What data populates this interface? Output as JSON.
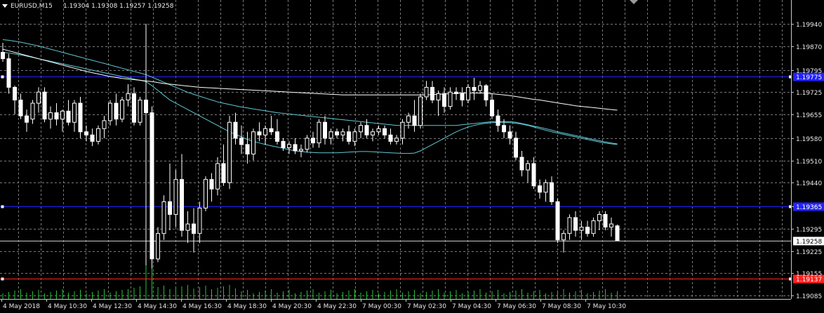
{
  "header": {
    "symbol": "EURUSD,M15",
    "ohlc": "1.19304 1.19308 1.19257 1.19258"
  },
  "chart_data": {
    "type": "candlestick",
    "title": "EURUSD,M15",
    "ylim": [
      1.19085,
      1.19975
    ],
    "y_ticks": [
      "1.19940",
      "1.19870",
      "1.19795",
      "1.19725",
      "1.19655",
      "1.19580",
      "1.19510",
      "1.19440",
      "1.19365",
      "1.19295",
      "1.19225",
      "1.19155",
      "1.19085"
    ],
    "x_ticks": [
      "4 May 2018",
      "4 May 10:30",
      "4 May 12:30",
      "4 May 14:30",
      "4 May 16:30",
      "4 May 18:30",
      "4 May 20:30",
      "4 May 22:30",
      "7 May 00:30",
      "7 May 02:30",
      "7 May 04:30",
      "7 May 06:30",
      "7 May 08:30",
      "7 May 10:30"
    ],
    "grid": true,
    "background": "#000000",
    "colors": {
      "grid": "#7a7a7a",
      "candle": "#ffffff",
      "ma": "#ffffff",
      "bands": "#5fc9d4",
      "hline_blue": "#2222ff",
      "hline_red": "#ff2020",
      "bid": "#c8c8c8"
    },
    "horizontal_lines": [
      {
        "value": 1.19775,
        "label": "1.19775",
        "color": "#2222ff"
      },
      {
        "value": 1.19365,
        "label": "1.19365",
        "color": "#2222ff"
      },
      {
        "value": 1.19137,
        "label": "1.19137",
        "color": "#ff2020"
      }
    ],
    "bid": {
      "value": 1.19258,
      "label": "1.19258"
    },
    "candles": [
      [
        1.1985,
        1.1988,
        1.1982,
        1.1983
      ],
      [
        1.1983,
        1.19845,
        1.1972,
        1.1974
      ],
      [
        1.1974,
        1.19745,
        1.19655,
        1.197
      ],
      [
        1.197,
        1.1972,
        1.1964,
        1.1965
      ],
      [
        1.1965,
        1.1967,
        1.196,
        1.1963
      ],
      [
        1.1964,
        1.197,
        1.19625,
        1.1969
      ],
      [
        1.1969,
        1.1974,
        1.1966,
        1.19725
      ],
      [
        1.19725,
        1.1974,
        1.1963,
        1.1964
      ],
      [
        1.1964,
        1.1968,
        1.1961,
        1.1966
      ],
      [
        1.1966,
        1.1969,
        1.1962,
        1.1964
      ],
      [
        1.1964,
        1.1967,
        1.196,
        1.19665
      ],
      [
        1.19665,
        1.197,
        1.1962,
        1.1963
      ],
      [
        1.1963,
        1.197,
        1.196,
        1.1969
      ],
      [
        1.1969,
        1.1971,
        1.1958,
        1.196
      ],
      [
        1.196,
        1.1962,
        1.1957,
        1.1959
      ],
      [
        1.1959,
        1.1961,
        1.19555,
        1.1957
      ],
      [
        1.1957,
        1.1962,
        1.1956,
        1.1961
      ],
      [
        1.1961,
        1.1965,
        1.1958,
        1.19635
      ],
      [
        1.19635,
        1.197,
        1.1962,
        1.1969
      ],
      [
        1.1969,
        1.1972,
        1.1962,
        1.1964
      ],
      [
        1.1964,
        1.1971,
        1.1963,
        1.197
      ],
      [
        1.197,
        1.1975,
        1.1968,
        1.1972
      ],
      [
        1.1972,
        1.1974,
        1.1962,
        1.1963
      ],
      [
        1.1963,
        1.1971,
        1.1962,
        1.197
      ],
      [
        1.197,
        1.1994,
        1.1918,
        1.1966
      ],
      [
        1.1966,
        1.1968,
        1.1917,
        1.192
      ],
      [
        1.192,
        1.193,
        1.1919,
        1.1928
      ],
      [
        1.1928,
        1.194,
        1.1926,
        1.1938
      ],
      [
        1.1938,
        1.195,
        1.1929,
        1.1934
      ],
      [
        1.1934,
        1.1948,
        1.193,
        1.1945
      ],
      [
        1.1945,
        1.1953,
        1.1927,
        1.1929
      ],
      [
        1.1929,
        1.1935,
        1.1925,
        1.1931
      ],
      [
        1.1931,
        1.1936,
        1.1922,
        1.1928
      ],
      [
        1.1928,
        1.1938,
        1.1925,
        1.1936
      ],
      [
        1.1936,
        1.1946,
        1.1935,
        1.1945
      ],
      [
        1.1945,
        1.1947,
        1.1938,
        1.1942
      ],
      [
        1.1942,
        1.1952,
        1.194,
        1.195
      ],
      [
        1.195,
        1.1956,
        1.1943,
        1.1944
      ],
      [
        1.1944,
        1.1965,
        1.1942,
        1.1963
      ],
      [
        1.1963,
        1.1966,
        1.1956,
        1.1958
      ],
      [
        1.1958,
        1.1962,
        1.1953,
        1.1956
      ],
      [
        1.1956,
        1.196,
        1.195,
        1.1953
      ],
      [
        1.1953,
        1.1961,
        1.1951,
        1.196
      ],
      [
        1.196,
        1.1963,
        1.1957,
        1.1959
      ],
      [
        1.1959,
        1.1962,
        1.1956,
        1.1961
      ],
      [
        1.1961,
        1.1965,
        1.1959,
        1.196
      ],
      [
        1.196,
        1.1964,
        1.1956,
        1.1957
      ],
      [
        1.1957,
        1.1958,
        1.1954,
        1.1955
      ],
      [
        1.1955,
        1.1957,
        1.1953,
        1.1956
      ],
      [
        1.1956,
        1.1958,
        1.1953,
        1.1954
      ],
      [
        1.1954,
        1.1956,
        1.1952,
        1.19545
      ],
      [
        1.19545,
        1.1959,
        1.19535,
        1.1958
      ],
      [
        1.1958,
        1.196,
        1.1955,
        1.19565
      ],
      [
        1.19565,
        1.1964,
        1.1955,
        1.1963
      ],
      [
        1.1963,
        1.1965,
        1.1956,
        1.1958
      ],
      [
        1.1958,
        1.1961,
        1.1956,
        1.196
      ],
      [
        1.196,
        1.1961,
        1.1958,
        1.1959
      ],
      [
        1.1959,
        1.1961,
        1.1957,
        1.196
      ],
      [
        1.196,
        1.1962,
        1.1956,
        1.1957
      ],
      [
        1.1957,
        1.1961,
        1.19555,
        1.196
      ],
      [
        1.196,
        1.1963,
        1.1958,
        1.1962
      ],
      [
        1.1962,
        1.1964,
        1.1958,
        1.1959
      ],
      [
        1.1959,
        1.1961,
        1.1957,
        1.196
      ],
      [
        1.196,
        1.1962,
        1.1959,
        1.1961
      ],
      [
        1.1961,
        1.1962,
        1.1958,
        1.1959
      ],
      [
        1.1959,
        1.1961,
        1.1956,
        1.1957
      ],
      [
        1.1957,
        1.1959,
        1.1956,
        1.1958
      ],
      [
        1.1958,
        1.1964,
        1.1956,
        1.1963
      ],
      [
        1.1963,
        1.1966,
        1.1961,
        1.1965
      ],
      [
        1.1965,
        1.197,
        1.196,
        1.1962
      ],
      [
        1.1962,
        1.1972,
        1.1961,
        1.1971
      ],
      [
        1.1971,
        1.1976,
        1.197,
        1.1974
      ],
      [
        1.1974,
        1.1976,
        1.1969,
        1.197
      ],
      [
        1.197,
        1.1973,
        1.1965,
        1.1972
      ],
      [
        1.1972,
        1.1974,
        1.1966,
        1.1968
      ],
      [
        1.1968,
        1.1974,
        1.1967,
        1.19725
      ],
      [
        1.19725,
        1.1974,
        1.197,
        1.1972
      ],
      [
        1.1972,
        1.1974,
        1.1968,
        1.197
      ],
      [
        1.197,
        1.1975,
        1.1969,
        1.1974
      ],
      [
        1.1974,
        1.1977,
        1.197,
        1.1973
      ],
      [
        1.1973,
        1.1976,
        1.1972,
        1.19745
      ],
      [
        1.19745,
        1.1975,
        1.1968,
        1.197
      ],
      [
        1.197,
        1.1972,
        1.1964,
        1.1965
      ],
      [
        1.1965,
        1.1967,
        1.196,
        1.1962
      ],
      [
        1.1962,
        1.1964,
        1.1958,
        1.196
      ],
      [
        1.196,
        1.1962,
        1.1956,
        1.1958
      ],
      [
        1.1958,
        1.196,
        1.1951,
        1.1952
      ],
      [
        1.1952,
        1.1954,
        1.1946,
        1.1948
      ],
      [
        1.1948,
        1.1951,
        1.1944,
        1.195
      ],
      [
        1.195,
        1.1952,
        1.1942,
        1.1943
      ],
      [
        1.1943,
        1.1945,
        1.1939,
        1.1941
      ],
      [
        1.1941,
        1.1945,
        1.1938,
        1.1944
      ],
      [
        1.1944,
        1.1946,
        1.1937,
        1.1938
      ],
      [
        1.1938,
        1.1939,
        1.1925,
        1.1926
      ],
      [
        1.1926,
        1.1929,
        1.1922,
        1.1928
      ],
      [
        1.1928,
        1.1934,
        1.1926,
        1.1933
      ],
      [
        1.1933,
        1.1935,
        1.1927,
        1.1929
      ],
      [
        1.1929,
        1.1932,
        1.1926,
        1.193
      ],
      [
        1.193,
        1.1932,
        1.1927,
        1.1928
      ],
      [
        1.1928,
        1.1933,
        1.1927,
        1.1932
      ],
      [
        1.1932,
        1.1935,
        1.1929,
        1.1934
      ],
      [
        1.1934,
        1.1935,
        1.1929,
        1.193
      ],
      [
        1.193,
        1.1933,
        1.1927,
        1.1931
      ],
      [
        1.19304,
        1.19308,
        1.19257,
        1.19258
      ]
    ],
    "ma": [
      1.1986,
      1.19855,
      1.1985,
      1.19845,
      1.1984,
      1.19835,
      1.1983,
      1.19825,
      1.1982,
      1.19815,
      1.1981,
      1.19805,
      1.198,
      1.19795,
      1.1979,
      1.19786,
      1.19782,
      1.19778,
      1.19774,
      1.19771,
      1.19768,
      1.19766,
      1.19764,
      1.19762,
      1.1976,
      1.19758,
      1.19755,
      1.19752,
      1.1975,
      1.19748,
      1.19746,
      1.19744,
      1.19742,
      1.1974,
      1.19739,
      1.19738,
      1.19737,
      1.19736,
      1.19735,
      1.19734,
      1.19733,
      1.19732,
      1.19731,
      1.1973,
      1.19729,
      1.19728,
      1.19727,
      1.19726,
      1.19725,
      1.19724,
      1.19723,
      1.19722,
      1.19721,
      1.1972,
      1.19719,
      1.19718,
      1.19717,
      1.19716,
      1.19716,
      1.19716,
      1.19716,
      1.19716,
      1.19716,
      1.19716,
      1.19716,
      1.19716,
      1.19716,
      1.19716,
      1.19716,
      1.19716,
      1.19716,
      1.19716,
      1.19717,
      1.19718,
      1.19719,
      1.1972,
      1.19721,
      1.19722,
      1.19722,
      1.19722,
      1.19722,
      1.19722,
      1.1972,
      1.19718,
      1.19716,
      1.19714,
      1.19711,
      1.19708,
      1.19705,
      1.19702,
      1.197,
      1.19697,
      1.19694,
      1.19691,
      1.19688,
      1.19685,
      1.19682,
      1.1968,
      1.19678,
      1.19676,
      1.19674,
      1.19672,
      1.1967,
      1.19668
    ],
    "band_upper": [
      1.1989,
      1.19888,
      1.19885,
      1.19882,
      1.19878,
      1.19874,
      1.1987,
      1.19865,
      1.1986,
      1.19855,
      1.1985,
      1.19845,
      1.1984,
      1.19835,
      1.1983,
      1.19825,
      1.1982,
      1.19815,
      1.1981,
      1.19805,
      1.198,
      1.19795,
      1.1979,
      1.19785,
      1.1978,
      1.19772,
      1.19764,
      1.19756,
      1.19748,
      1.1974,
      1.19732,
      1.19724,
      1.19718,
      1.19712,
      1.19706,
      1.197,
      1.19694,
      1.1969,
      1.19686,
      1.19682,
      1.19678,
      1.19675,
      1.19672,
      1.19669,
      1.19666,
      1.19663,
      1.1966,
      1.19658,
      1.19656,
      1.19654,
      1.19652,
      1.1965,
      1.19648,
      1.19646,
      1.19644,
      1.19642,
      1.1964,
      1.19638,
      1.19636,
      1.19634,
      1.19632,
      1.1963,
      1.19628,
      1.19626,
      1.19624,
      1.19622,
      1.1962,
      1.1962,
      1.1962,
      1.1962,
      1.1962,
      1.1962,
      1.1962,
      1.1962,
      1.1962,
      1.1962,
      1.1962,
      1.19622,
      1.19624,
      1.19626,
      1.19628,
      1.1963,
      1.19632,
      1.19632,
      1.19632,
      1.19632,
      1.1963,
      1.19626,
      1.19622,
      1.19618,
      1.19614,
      1.1961,
      1.19605,
      1.196,
      1.19596,
      1.19592,
      1.19588,
      1.19584,
      1.1958,
      1.19576,
      1.19572,
      1.19568,
      1.19565,
      1.19562
    ],
    "band_lower": [
      1.1985,
      1.19848,
      1.19845,
      1.19842,
      1.19838,
      1.19834,
      1.1983,
      1.19826,
      1.19822,
      1.19818,
      1.19814,
      1.1981,
      1.19806,
      1.19802,
      1.19798,
      1.19794,
      1.1979,
      1.19786,
      1.19782,
      1.19778,
      1.19774,
      1.1977,
      1.19766,
      1.19762,
      1.19758,
      1.19745,
      1.1973,
      1.19715,
      1.197,
      1.1969,
      1.1968,
      1.1967,
      1.1966,
      1.1965,
      1.1964,
      1.1963,
      1.1962,
      1.1961,
      1.196,
      1.19592,
      1.19584,
      1.19576,
      1.1957,
      1.19565,
      1.1956,
      1.19556,
      1.19552,
      1.19548,
      1.19544,
      1.1954,
      1.19538,
      1.19536,
      1.19535,
      1.19534,
      1.19534,
      1.19534,
      1.19534,
      1.19535,
      1.19536,
      1.19537,
      1.19538,
      1.19538,
      1.19537,
      1.19536,
      1.19535,
      1.19534,
      1.19533,
      1.19532,
      1.19532,
      1.19533,
      1.1954,
      1.1955,
      1.1956,
      1.1957,
      1.1958,
      1.1959,
      1.196,
      1.19608,
      1.19615,
      1.1962,
      1.19624,
      1.19627,
      1.19629,
      1.1963,
      1.1963,
      1.19629,
      1.19627,
      1.19624,
      1.1962,
      1.19615,
      1.1961,
      1.19605,
      1.196,
      1.19596,
      1.19592,
      1.19588,
      1.19584,
      1.1958,
      1.19576,
      1.19572,
      1.19568,
      1.19565,
      1.19562,
      1.1956
    ]
  }
}
